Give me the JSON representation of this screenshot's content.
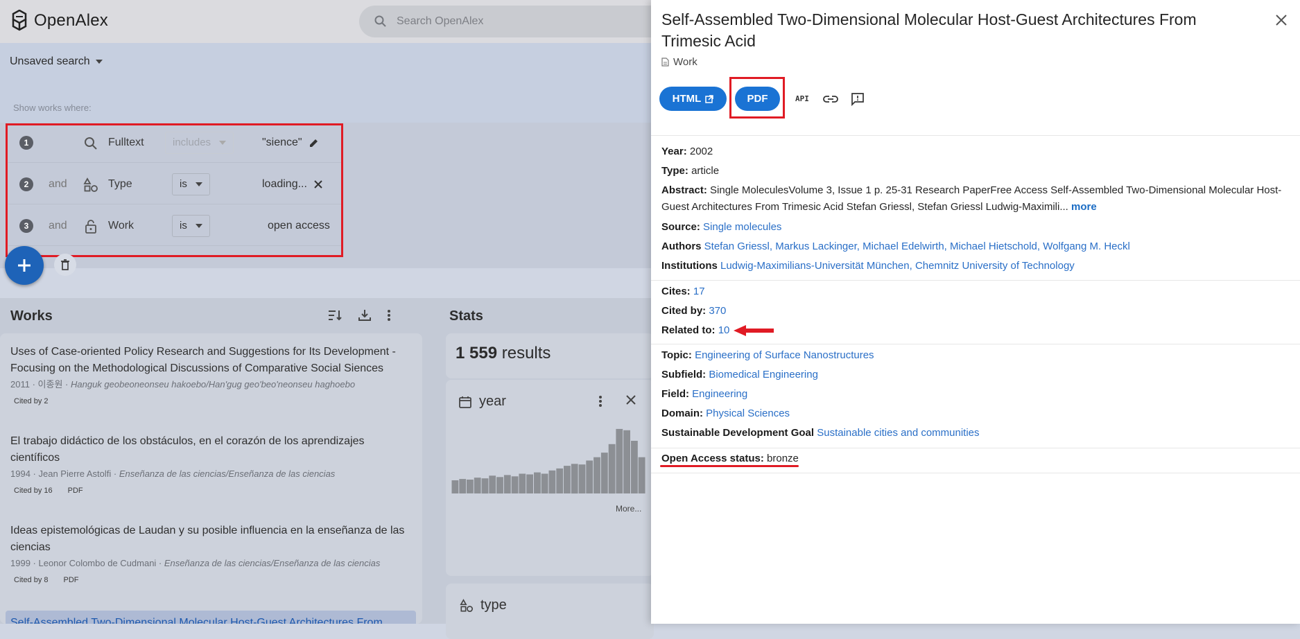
{
  "app": {
    "name": "OpenAlex"
  },
  "search": {
    "placeholder": "Search OpenAlex"
  },
  "subbar": {
    "search_label": "Unsaved search",
    "show_where": "Show works where:"
  },
  "filters": [
    {
      "num": "1",
      "conj": "",
      "icon": "search-icon",
      "label": "Fulltext",
      "op": "includes",
      "value": "\"sience\""
    },
    {
      "num": "2",
      "conj": "and",
      "icon": "type-icon",
      "label": "Type",
      "op": "is",
      "value": "loading..."
    },
    {
      "num": "3",
      "conj": "and",
      "icon": "lock-open-icon",
      "label": "Work",
      "op": "is",
      "value": "open access"
    }
  ],
  "works": {
    "title": "Works",
    "items": [
      {
        "title": "Uses of Case-oriented Policy Research and Suggestions for Its Development - Focusing on the Methodological Discussions of Comparative Social Siences",
        "year": "2011",
        "authors": "이종원",
        "venue": "Hanguk geobeoneonseu hakoebo/Han'gug geo'beo'neonseu haghoebo",
        "cited": "Cited by 2",
        "pdf": ""
      },
      {
        "title": "El trabajo didáctico de los obstáculos, en el corazón de los aprendizajes científicos",
        "year": "1994",
        "authors": "Jean Pierre Astolfi",
        "venue": "Enseñanza de las ciencias/Enseñanza de las ciencias",
        "cited": "Cited by 16",
        "pdf": "PDF"
      },
      {
        "title": "Ideas epistemológicas de Laudan y su posible influencia en la enseñanza de las ciencias",
        "year": "1999",
        "authors": "Leonor Colombo de Cudmani",
        "venue": "Enseñanza de las ciencias/Enseñanza de las ciencias",
        "cited": "Cited by 8",
        "pdf": "PDF"
      },
      {
        "title": "Self-Assembled Two-Dimensional Molecular Host-Guest Architectures From"
      }
    ]
  },
  "stats": {
    "title": "Stats",
    "count": "1 559",
    "count_label": "results",
    "year_card": {
      "title": "year",
      "more": "More...",
      "histogram": [
        0.2,
        0.22,
        0.21,
        0.24,
        0.23,
        0.27,
        0.25,
        0.28,
        0.26,
        0.3,
        0.29,
        0.32,
        0.3,
        0.35,
        0.38,
        0.42,
        0.45,
        0.44,
        0.5,
        0.55,
        0.62,
        0.75,
        0.98,
        0.96,
        0.8,
        0.55
      ]
    },
    "type_card": {
      "title": "type"
    }
  },
  "drawer": {
    "title": "Self-Assembled Two-Dimensional Molecular Host-Guest Architectures From Trimesic Acid",
    "kind": "Work",
    "buttons": {
      "html": "HTML",
      "pdf": "PDF",
      "api": "API"
    },
    "year_label": "Year:",
    "year": "2002",
    "type_label": "Type:",
    "type": "article",
    "abstract_label": "Abstract:",
    "abstract": "Single MoleculesVolume 3, Issue 1 p. 25-31 Research PaperFree Access Self-Assembled Two-Dimensional Molecular Host-Guest Architectures From Trimesic Acid Stefan Griessl, Stefan Griessl Ludwig-Maximili...",
    "more": "more",
    "source_label": "Source:",
    "source": "Single molecules",
    "authors_label": "Authors",
    "authors": [
      "Stefan Griessl,",
      "Markus Lackinger,",
      "Michael Edelwirth,",
      "Michael Hietschold,",
      "Wolfgang M. Heckl"
    ],
    "institutions_label": "Institutions",
    "institutions": [
      "Ludwig-Maximilians-Universität München,",
      "Chemnitz University of Technology"
    ],
    "cites_label": "Cites:",
    "cites": "17",
    "cited_by_label": "Cited by:",
    "cited_by": "370",
    "related_label": "Related to:",
    "related": "10",
    "topic_label": "Topic:",
    "topic": "Engineering of Surface Nanostructures",
    "subfield_label": "Subfield:",
    "subfield": "Biomedical Engineering",
    "field_label": "Field:",
    "field": "Engineering",
    "domain_label": "Domain:",
    "domain": "Physical Sciences",
    "sdg_label": "Sustainable Development Goal",
    "sdg": "Sustainable cities and communities",
    "oa_label": "Open Access status:",
    "oa": "bronze"
  },
  "colors": {
    "accent": "#1a73d4",
    "link": "#2a6fc7",
    "annotation": "#e01b24",
    "overlay": "#c4cad8"
  }
}
